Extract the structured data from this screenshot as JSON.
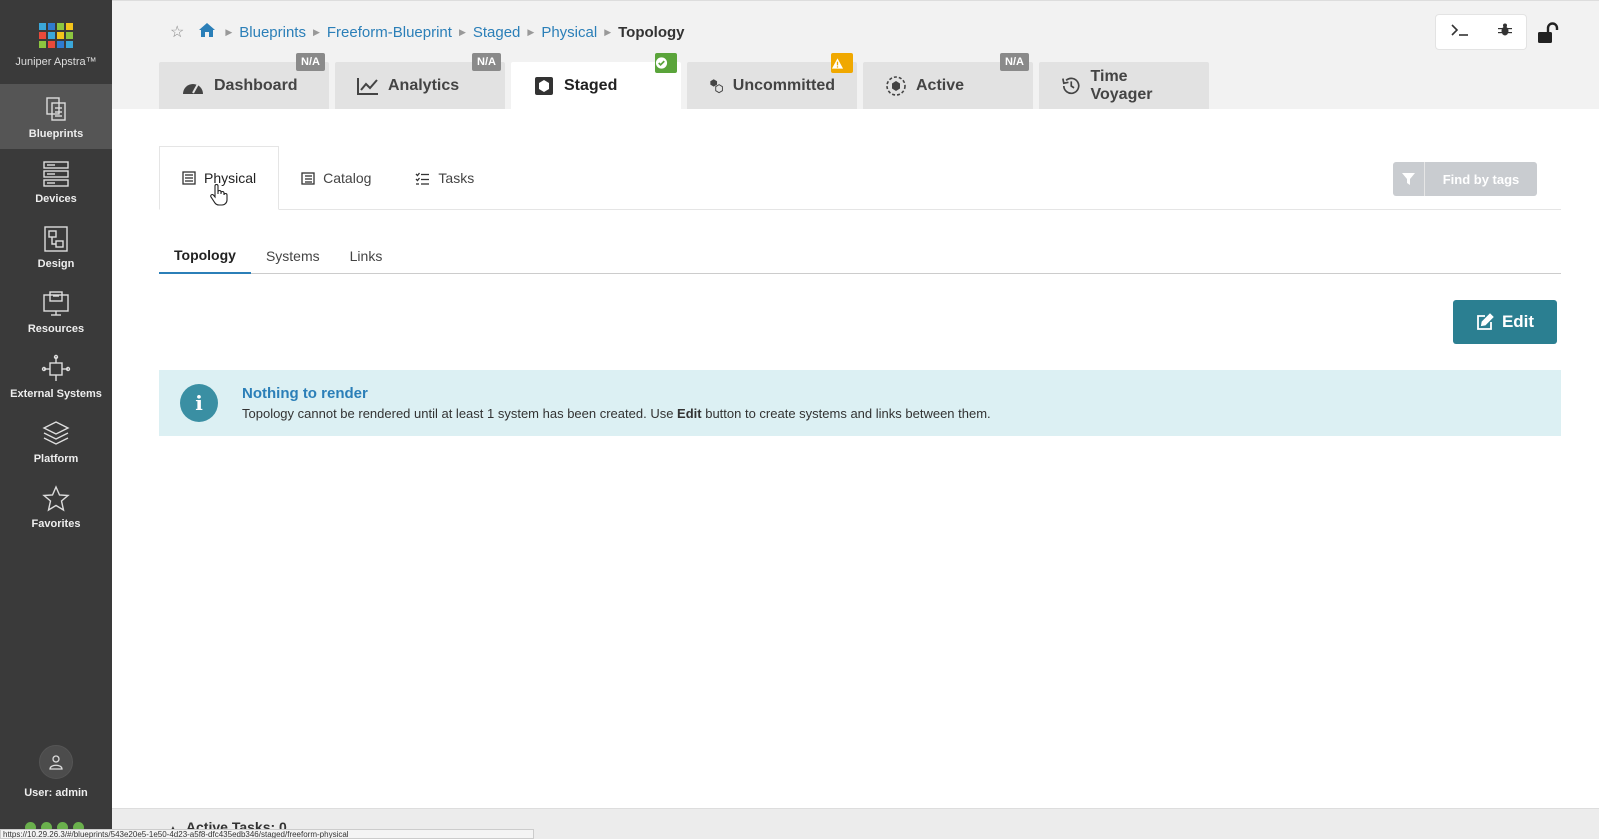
{
  "app": {
    "name": "Juniper Apstra™"
  },
  "colors": {
    "sidebar": "#3a3a3a",
    "link": "#2b7fb8",
    "edit_button": "#2b7f91",
    "alert_bg": "#dcf0f3",
    "ok_badge": "#5aa43a",
    "warn_badge": "#f0a800"
  },
  "sidebar": {
    "items": [
      {
        "label": "Blueprints",
        "icon": "blueprints-icon"
      },
      {
        "label": "Devices",
        "icon": "devices-icon"
      },
      {
        "label": "Design",
        "icon": "design-icon"
      },
      {
        "label": "Resources",
        "icon": "resources-icon"
      },
      {
        "label": "External Systems",
        "icon": "external-systems-icon"
      },
      {
        "label": "Platform",
        "icon": "platform-icon"
      },
      {
        "label": "Favorites",
        "icon": "star-icon"
      }
    ],
    "user": "User: admin"
  },
  "breadcrumb": {
    "items": [
      "Blueprints",
      "Freeform-Blueprint",
      "Staged",
      "Physical"
    ],
    "current": "Topology"
  },
  "main_tabs": [
    {
      "label": "Dashboard",
      "badge": "N/A"
    },
    {
      "label": "Analytics",
      "badge": "N/A"
    },
    {
      "label": "Staged",
      "badge": "ok"
    },
    {
      "label": "Uncommitted",
      "badge": "warning"
    },
    {
      "label": "Active",
      "badge": "N/A"
    },
    {
      "label": "Time Voyager",
      "badge": ""
    }
  ],
  "sub_tabs": [
    "Physical",
    "Catalog",
    "Tasks"
  ],
  "find_by_tags": "Find by tags",
  "view_tabs": [
    "Topology",
    "Systems",
    "Links"
  ],
  "edit_button": "Edit",
  "alert": {
    "title": "Nothing to render",
    "message_pre": "Topology cannot be rendered until at least 1 system has been created. Use ",
    "message_bold": "Edit",
    "message_post": " button to create systems and links between them."
  },
  "footer": {
    "tasks": "Active Tasks: 0"
  },
  "status_url": "https://10.29.26.3/#/blueprints/543e20e5-1e50-4d23-a5f8-dfc435edb346/staged/freeform-physical"
}
